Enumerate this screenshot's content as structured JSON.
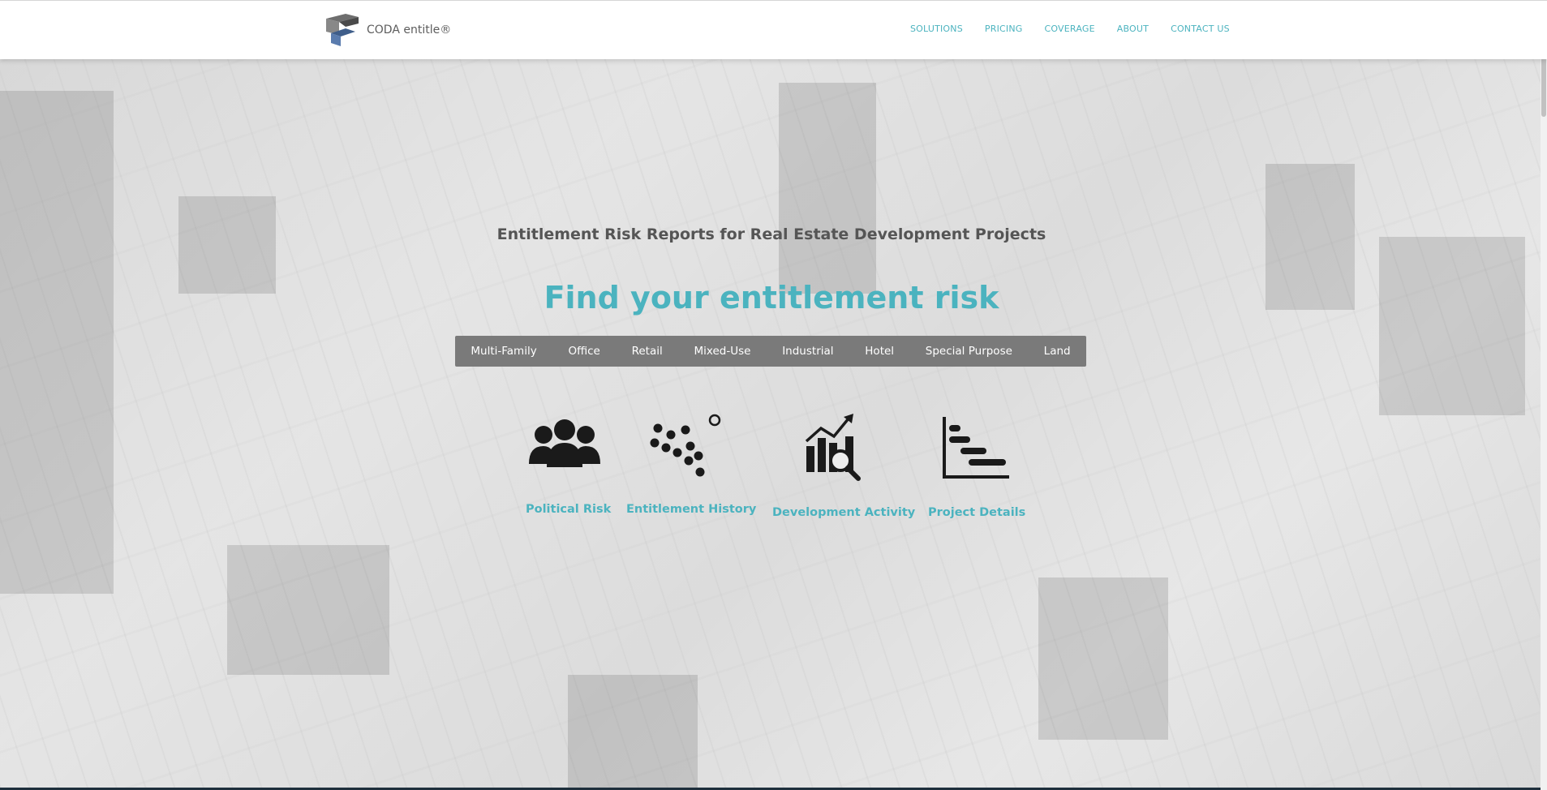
{
  "header": {
    "logo_text": "CODA entitle®",
    "nav": [
      "SOLUTIONS",
      "PRICING",
      "COVERAGE",
      "ABOUT",
      "CONTACT US"
    ]
  },
  "hero": {
    "subtitle": "Entitlement Risk Reports for Real Estate Development Projects",
    "headline": "Find your entitlement risk",
    "categories": [
      "Multi-Family",
      "Office",
      "Retail",
      "Mixed-Use",
      "Industrial",
      "Hotel",
      "Special Purpose",
      "Land"
    ]
  },
  "features": [
    {
      "label": "Political Risk",
      "icon": "people-group-icon"
    },
    {
      "label": "Entitlement History",
      "icon": "scatter-dots-icon"
    },
    {
      "label": "Development Activity",
      "icon": "bar-chart-magnifier-icon"
    },
    {
      "label": "Project Details",
      "icon": "gantt-chart-icon"
    }
  ],
  "colors": {
    "accent": "#4bb3bf",
    "category_bar": "#7a7a7a",
    "subtitle": "#555555"
  }
}
